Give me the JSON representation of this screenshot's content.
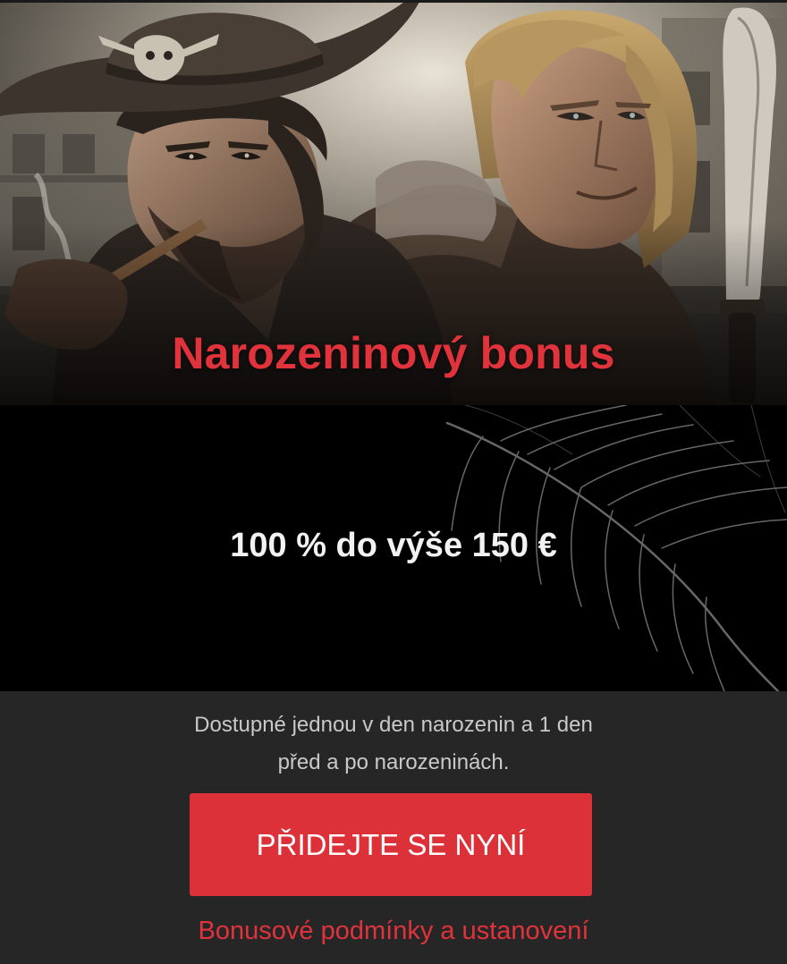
{
  "hero": {
    "title": "Narozeninový bonus"
  },
  "offer": {
    "headline": "100 % do výše 150 €"
  },
  "info": {
    "line1": "Dostupné jednou v den narozenin a 1 den",
    "line2": "před a po narozeninách."
  },
  "cta": {
    "label": "PŘIDEJTE SE NYNÍ"
  },
  "terms": {
    "label": "Bonusové podmínky a ustanovení"
  },
  "colors": {
    "accent": "#dd3139",
    "background": "#262626",
    "offer_band": "#000000",
    "info_text": "#c9c9c9"
  }
}
